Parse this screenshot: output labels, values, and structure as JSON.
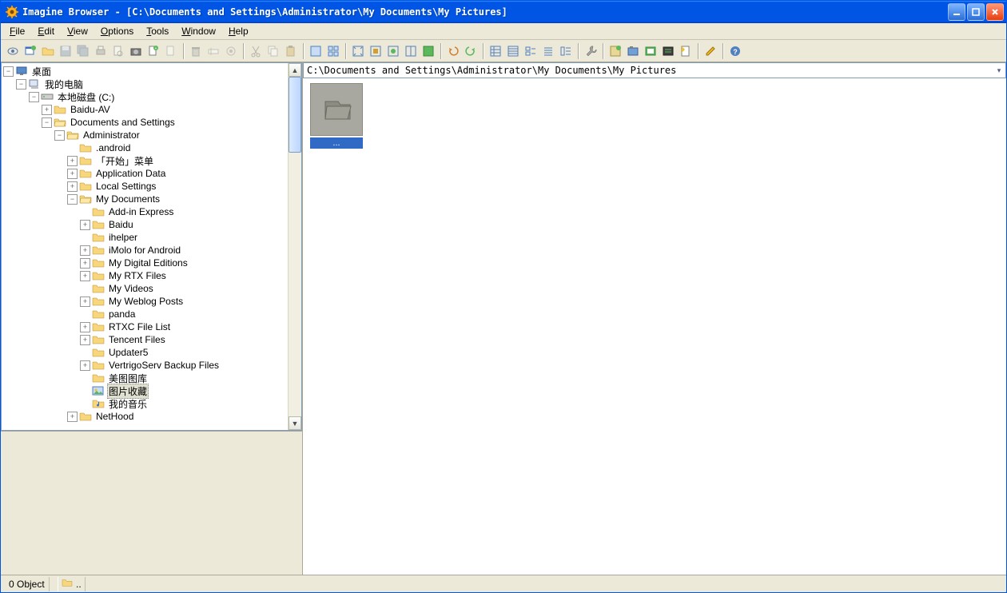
{
  "window": {
    "title": "Imagine Browser - [C:\\Documents and Settings\\Administrator\\My Documents\\My Pictures]"
  },
  "menus": {
    "file": "File",
    "edit": "Edit",
    "view": "View",
    "options": "Options",
    "tools": "Tools",
    "window": "Window",
    "help": "Help"
  },
  "tree": {
    "desktop": "桌面",
    "mycomputer": "我的电脑",
    "hdd": "本地磁盘 (C:)",
    "baiduav": "Baidu-AV",
    "docset": "Documents and Settings",
    "admin": "Administrator",
    "android": ".android",
    "startmenu": "「开始」菜单",
    "appdata": "Application Data",
    "localset": "Local Settings",
    "mydocs": "My Documents",
    "addin": "Add-in Express",
    "baidu": "Baidu",
    "ihelper": "ihelper",
    "imolo": "iMolo for Android",
    "mde": "My Digital Editions",
    "rtx": "My RTX Files",
    "myvideos": "My Videos",
    "weblog": "My Weblog Posts",
    "panda": "panda",
    "rtxc": "RTXC File List",
    "tencent": "Tencent Files",
    "updater": "Updater5",
    "vertrigo": "VertrigoServ Backup Files",
    "meitu": "美图图库",
    "picfav": "图片收藏",
    "mymusic": "我的音乐",
    "nethood": "NetHood"
  },
  "address": {
    "path": "C:\\Documents and Settings\\Administrator\\My Documents\\My Pictures"
  },
  "content": {
    "thumb1_label": "..."
  },
  "status": {
    "count": "0 Object",
    "path": ".."
  }
}
